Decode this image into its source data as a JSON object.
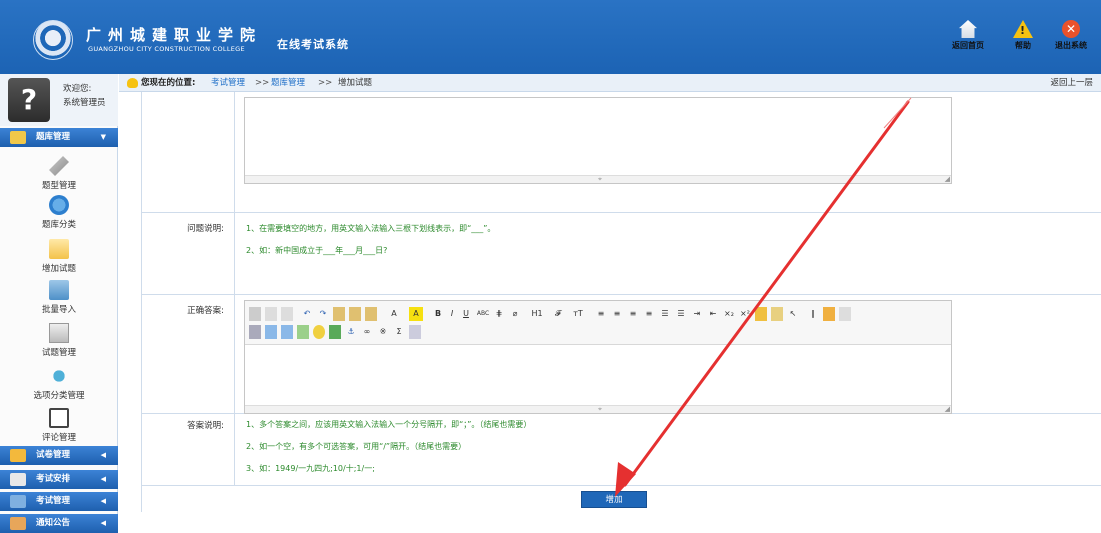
{
  "header": {
    "school_name": "广州城建职业学院",
    "school_name_en": "GUANGZHOU CITY CONSTRUCTION COLLEGE",
    "system_title": "在线考试系统",
    "home_label": "返回首页",
    "help_label": "帮助",
    "exit_label": "退出系统"
  },
  "sidebar": {
    "welcome": "欢迎您:",
    "username": "系统管理员",
    "active_menu": "题库管理",
    "sub_items": [
      {
        "label": "题型管理"
      },
      {
        "label": "题库分类"
      },
      {
        "label": "增加试题"
      },
      {
        "label": "批量导入"
      },
      {
        "label": "试题管理"
      },
      {
        "label": "选项分类管理"
      },
      {
        "label": "评论管理"
      }
    ],
    "menus": [
      {
        "label": "试卷管理"
      },
      {
        "label": "考试安排"
      },
      {
        "label": "考试管理"
      },
      {
        "label": "通知公告"
      }
    ]
  },
  "breadcrumb": {
    "label": "您现在的位置:",
    "items": [
      "考试管理",
      "题库管理",
      "增加试题"
    ],
    "separator": ">>",
    "back": "返回上一层"
  },
  "form": {
    "question_note_label": "问题说明:",
    "question_note_lines": [
      "1、在需要填空的地方，用英文输入法输入三根下划线表示，即“___”。",
      "2、如：新中国成立于___年___月___日?"
    ],
    "answer_label": "正确答案:",
    "answer_note_label": "答案说明:",
    "answer_note_lines": [
      "1、多个答案之间，应该用英文输入法输入一个分号隔开，即“；”。（结尾也需要）",
      "2、如一个空，有多个可选答案，可用“/”隔开。（结尾也需要）",
      "3、如：1949/一九四九;10/十;1/一;"
    ],
    "submit_label": "增加"
  },
  "toolbar": {
    "row1": [
      "H1",
      "𝓕",
      "тT",
      "A",
      "A",
      "B",
      "I",
      "U",
      "ABC",
      "⋕",
      "Σ"
    ]
  },
  "colors": {
    "header_blue": "#1c63b4",
    "arrow_red": "#e53030",
    "note_green": "#2c8a2c"
  }
}
